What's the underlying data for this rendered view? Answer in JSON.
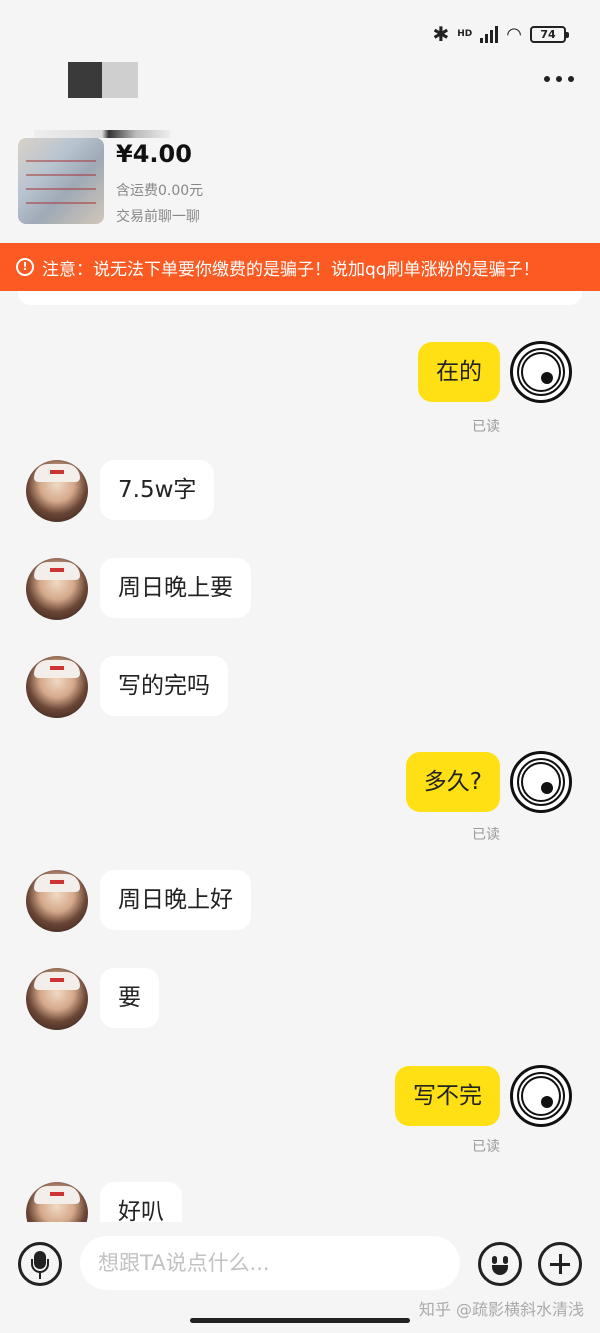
{
  "status_bar": {
    "hd_label": "HD",
    "battery": "74"
  },
  "product": {
    "price": "¥4.00",
    "shipping": "含运费0.00元",
    "chat_hint": "交易前聊一聊"
  },
  "warning": {
    "icon": "!",
    "text": "注意：说无法下单要你缴费的是骗子！说加qq刷单涨粉的是骗子！"
  },
  "messages": [
    {
      "side": "right",
      "text": "在的",
      "read": "已读"
    },
    {
      "side": "left",
      "text": "7.5w字"
    },
    {
      "side": "left",
      "text": "周日晚上要"
    },
    {
      "side": "left",
      "text": "写的完吗"
    },
    {
      "side": "right",
      "text": "多久?",
      "read": "已读"
    },
    {
      "side": "left",
      "text": "周日晚上好"
    },
    {
      "side": "left",
      "text": "要"
    },
    {
      "side": "right",
      "text": "写不完",
      "read": "已读"
    },
    {
      "side": "left",
      "text": "好叭"
    }
  ],
  "input": {
    "placeholder": "想跟TA说点什么..."
  },
  "watermark": "知乎 @疏影横斜水清浅",
  "colors": {
    "accent_yellow": "#ffe015",
    "warning_orange": "#fb5a22"
  }
}
